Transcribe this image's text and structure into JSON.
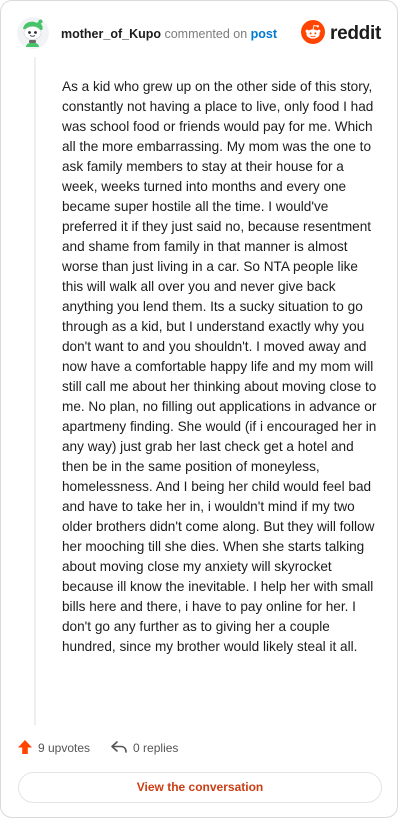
{
  "header": {
    "username": "mother_of_Kupo",
    "action_text": " commented on ",
    "post_link": "post",
    "brand_name": "reddit",
    "brand_color": "#ff4500"
  },
  "comment": {
    "body": "As a kid who grew up on the other side of this story, constantly not having a place to live, only food I had was school food or friends would pay for me. Which all the more embarrassing. My mom was the one to ask family members to stay at their house for a week, weeks turned into months and every one became super hostile all the time. I would've preferred it if they just said no, because resentment and shame from family in that manner is almost worse than just living in a car. So NTA people like this will walk all over you and never give back anything you lend them. Its a sucky situation to go through as a kid, but I understand exactly why you don't want to and you shouldn't. I moved away and now have a comfortable happy life and my mom will still call me about her thinking about moving close to me. No plan, no filling out applications in advance or apartmeny finding. She would (if i encouraged her in any way) just grab her last check get a hotel and then be in the same position of moneyless, homelessness. And I being her child would feel bad and have to take her in, i wouldn't mind if my two older brothers didn't come along. But they will follow her mooching till she dies. When she starts talking about moving close my anxiety will skyrocket because ill know the inevitable. I help her with small bills here and there, i have to pay online for her. I don't go any further as to giving her a couple hundred, since my brother would likely steal it all."
  },
  "footer": {
    "upvotes": "9 upvotes",
    "replies": "0 replies",
    "view_button": "View the conversation",
    "upvote_color": "#ff4500",
    "link_color": "#cc3d14"
  },
  "icons": {
    "avatar": "snoo-avatar-icon",
    "brand": "reddit-logo-icon",
    "upvote": "upvote-arrow-icon",
    "reply": "reply-arrow-icon"
  }
}
